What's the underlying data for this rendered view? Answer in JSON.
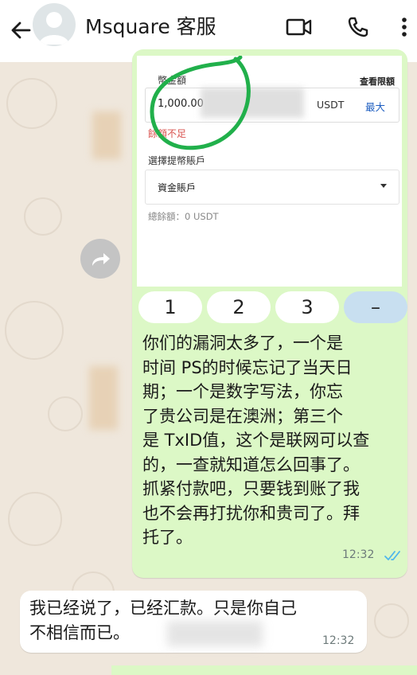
{
  "header": {
    "contact_name": "Msquare 客服",
    "back_icon": "arrow-left-icon",
    "video_icon": "video-call-icon",
    "phone_icon": "phone-icon",
    "menu_icon": "more-vertical-icon"
  },
  "screenshot_card": {
    "amount_label": "幣金額",
    "view_limit": "查看限額",
    "amount_value": "1,000.00",
    "currency": "USDT",
    "max_label": "最大",
    "error_text": "餘額不足",
    "account_label": "選擇提幣賬戶",
    "account_value": "資金賬戶",
    "total_balance": "總餘額：0 USDT"
  },
  "keypad": {
    "k1": "1",
    "k2": "2",
    "k3": "3",
    "k4": "–"
  },
  "outgoing_message": {
    "text": "你们的漏洞太多了，一个是\n时间 PS的时候忘记了当天日\n期；一个是数字写法，你忘\n了贵公司是在澳洲；第三个\n是 TxID值，这个是联网可以查\n的，一查就知道怎么回事了。\n抓紧付款吧，只要钱到账了我\n也不会再打扰你和贵司了。拜\n托了。",
    "time": "12:32"
  },
  "incoming_message": {
    "text": "我已经说了，已经汇款。只是你自己\n不相信而已。",
    "time": "12:32"
  },
  "colors": {
    "outgoing_bubble": "#dcf8c6",
    "incoming_bubble": "#ffffff",
    "chat_background": "#efe7dd",
    "read_ticks": "#4fb6ec",
    "error_red": "#d9534f",
    "link_blue": "#1f5fc1",
    "circle_annotation": "#21b04b"
  }
}
